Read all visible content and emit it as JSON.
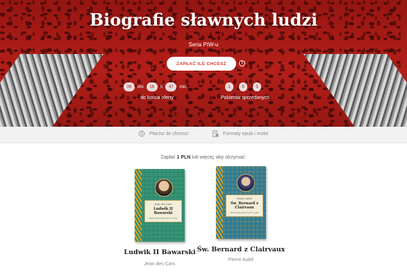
{
  "hero": {
    "title": "Biografie sławnych ludzi",
    "subtitle": "Seria PIW-u",
    "pay_button": "ZAPŁAĆ ILE CHCESZ",
    "info_icon": "info-icon",
    "countdown": {
      "days": "06",
      "days_unit": "dni",
      "hours": "16",
      "hours_unit": "h",
      "minutes": "47",
      "minutes_unit": "min",
      "label": "do końca oferty"
    },
    "sold": {
      "digits": [
        "1",
        "9",
        "5"
      ],
      "label": "Pakietów sprzedanych"
    }
  },
  "features": {
    "items": [
      {
        "icon": "coin-hand-icon",
        "label": "Płacisz ile chcesz!"
      },
      {
        "icon": "document-icon",
        "label": "Formaty epub i mobi!"
      }
    ]
  },
  "offer": {
    "prefix": "Zapłać ",
    "amount": "1 PLN",
    "suffix": " lub więcej, aby otrzymać:"
  },
  "books": [
    {
      "title": "Ludwik II Bawarski",
      "author": "Jean des Cars",
      "cover_author": "Jean des Cars",
      "cover_title": "Ludwik II Bawarski",
      "cover_series": "Biblioteka Sławnych Ludzi"
    },
    {
      "title": "Św. Bernard z Clairvaux",
      "author": "Pierre Aubé",
      "cover_author": "Pierre Aubé",
      "cover_title": "Św. Bernard z Clairvaux",
      "cover_series": "Biblioteka Sławnych Ludzi"
    }
  ],
  "colors": {
    "hero_red": "#c4211b",
    "button_text": "#d0392f",
    "features_bg": "#f2f2f2"
  }
}
